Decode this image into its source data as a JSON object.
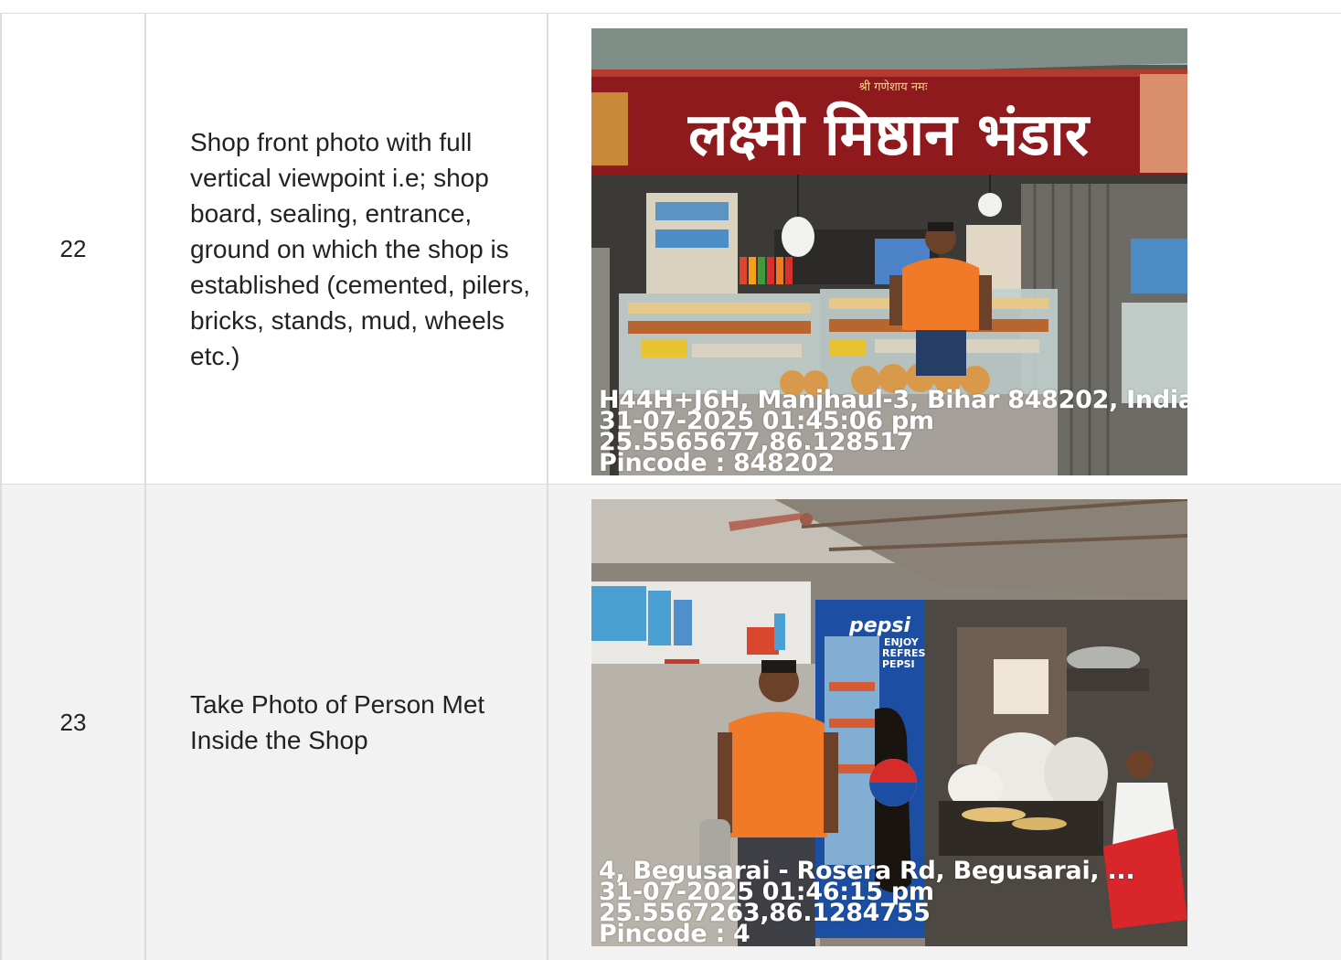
{
  "rows": [
    {
      "number": "22",
      "description": "Shop front photo with full vertical viewpoint i.e; shop board, sealing, entrance, ground on which the shop is established (cemented, pilers, bricks, stands, mud, wheels etc.)",
      "photo": {
        "sign_small": "श्री गणेशाय नमः",
        "sign_main": "लक्ष्मी मिष्ठान भंडार",
        "address": "H44H+J6H, Manjhaul-3, Bihar 848202, India",
        "datetime": "31-07-2025 01:45:06 pm",
        "coords": "25.5565677,86.128517",
        "pincode": "Pincode : 848202"
      }
    },
    {
      "number": "23",
      "description": "Take Photo of Person Met Inside the Shop",
      "photo": {
        "fridge_brand": "pepsi",
        "fridge_slogan_1": "ENJOY",
        "fridge_slogan_2": "REFRESHING",
        "fridge_slogan_3": "PEPSI",
        "address": "4, Begusarai - Rosera Rd, Begusarai, ...",
        "datetime": "31-07-2025 01:46:15 pm",
        "coords": "25.5567263,86.1284755",
        "pincode": "Pincode : 4"
      }
    }
  ],
  "colors": {
    "border": "#dcdcdc",
    "alt_row": "#f2f2f2",
    "sign_red": "#9b1a1f",
    "shirt_orange": "#f07a28",
    "pepsi_blue": "#1c4fa3"
  }
}
